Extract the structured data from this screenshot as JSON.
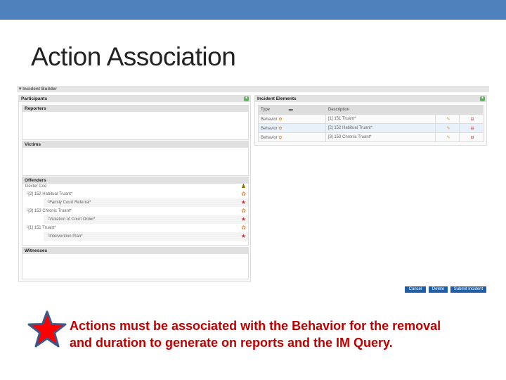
{
  "slide": {
    "title": "Action Association",
    "note": "Actions must be associated with the Behavior for the removal and duration to generate on reports and the IM Query.",
    "star_color": "#ff0000",
    "bar_color": "#4f81bd"
  },
  "builder": {
    "header": "Incident Builder",
    "participants": {
      "label": "Participants",
      "reporters": "Reporters",
      "victims": "Victims",
      "offenders": "Offenders",
      "witnesses": "Witnesses",
      "offender_name": "Dexter Coe",
      "items": [
        {
          "behavior": "[2] 152 Habitual Truant*",
          "action": "Family Court Referral*"
        },
        {
          "behavior": "[3] 153 Chronic Truant*",
          "action": "Violation of Court Order*"
        },
        {
          "behavior": "[1] 151 Truant*",
          "action": "Intervention Plan*"
        }
      ]
    },
    "elements": {
      "label": "Incident Elements",
      "columns": [
        "Type",
        "Description"
      ],
      "rows": [
        {
          "type": "Behavior",
          "description": "[1] 151 Truant*"
        },
        {
          "type": "Behavior",
          "description": "[2] 152 Habitual Truant*"
        },
        {
          "type": "Behavior",
          "description": "[3] 153 Chronic Truant*"
        }
      ]
    },
    "buttons": {
      "cancel": "Cancel",
      "delete": "Delete",
      "submit": "Submit Incident"
    }
  }
}
